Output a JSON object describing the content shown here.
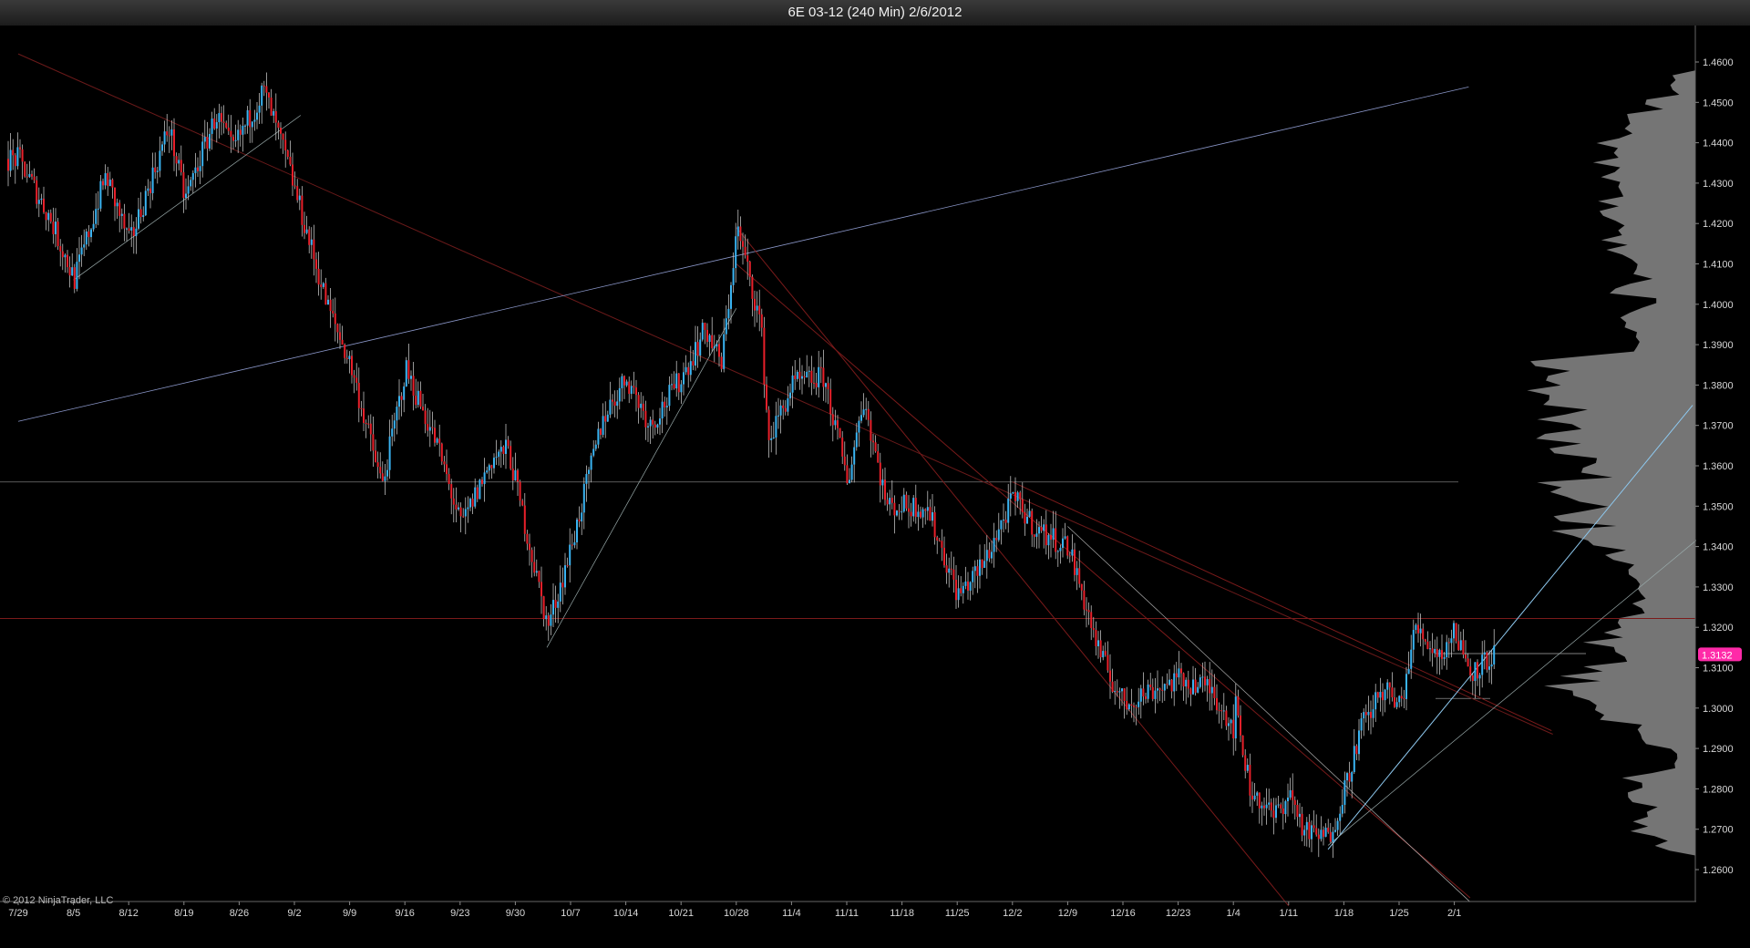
{
  "window": {
    "title": "6E 03-12 (240 Min)  2/6/2012"
  },
  "copyright": "© 2012 NinjaTrader, LLC",
  "chart_data": {
    "type": "candlestick",
    "instrument": "6E 03-12",
    "interval": "240 Min",
    "x_tick_labels": [
      "7/29",
      "8/5",
      "8/12",
      "8/19",
      "8/26",
      "9/2",
      "9/9",
      "9/16",
      "9/23",
      "9/30",
      "10/7",
      "10/14",
      "10/21",
      "10/28",
      "11/4",
      "11/11",
      "11/18",
      "11/25",
      "12/2",
      "12/9",
      "12/16",
      "12/23",
      "1/4",
      "1/11",
      "1/18",
      "1/25",
      "2/1"
    ],
    "y_tick_labels": [
      "1.4600",
      "1.4500",
      "1.4400",
      "1.4300",
      "1.4200",
      "1.4100",
      "1.4000",
      "1.3900",
      "1.3800",
      "1.3700",
      "1.3600",
      "1.3500",
      "1.3400",
      "1.3300",
      "1.3200",
      "1.3100",
      "1.3000",
      "1.2900",
      "1.2800",
      "1.2700",
      "1.2600"
    ],
    "ylim": [
      1.2515,
      1.4725
    ],
    "last_price": "1.3132",
    "grid": false,
    "colors": {
      "background": "#000000",
      "up": "#3ab4f2",
      "down": "#e8202a",
      "wick": "#d8d8d8",
      "price_badge": "#ff2aa8",
      "profile": "#8a8a8a"
    },
    "swing_points": [
      {
        "date": "7/29",
        "price": 1.436
      },
      {
        "date": "8/2",
        "price": 1.421
      },
      {
        "date": "8/5",
        "price": 1.406
      },
      {
        "date": "8/9",
        "price": 1.432
      },
      {
        "date": "8/12",
        "price": 1.415
      },
      {
        "date": "8/17",
        "price": 1.444
      },
      {
        "date": "8/19",
        "price": 1.426
      },
      {
        "date": "8/23",
        "price": 1.447
      },
      {
        "date": "8/25",
        "price": 1.438
      },
      {
        "date": "8/29",
        "price": 1.453
      },
      {
        "date": "9/1",
        "price": 1.435
      },
      {
        "date": "9/6",
        "price": 1.4
      },
      {
        "date": "9/9",
        "price": 1.385
      },
      {
        "date": "9/13",
        "price": 1.355
      },
      {
        "date": "9/16",
        "price": 1.384
      },
      {
        "date": "9/20",
        "price": 1.365
      },
      {
        "date": "9/23",
        "price": 1.345
      },
      {
        "date": "9/27",
        "price": 1.362
      },
      {
        "date": "9/29",
        "price": 1.364
      },
      {
        "date": "10/4",
        "price": 1.32
      },
      {
        "date": "10/7",
        "price": 1.34
      },
      {
        "date": "10/11",
        "price": 1.372
      },
      {
        "date": "10/14",
        "price": 1.382
      },
      {
        "date": "10/17",
        "price": 1.37
      },
      {
        "date": "10/21",
        "price": 1.382
      },
      {
        "date": "10/24",
        "price": 1.394
      },
      {
        "date": "10/26",
        "price": 1.385
      },
      {
        "date": "10/28",
        "price": 1.419
      },
      {
        "date": "10/31",
        "price": 1.395
      },
      {
        "date": "11/1",
        "price": 1.366
      },
      {
        "date": "11/4",
        "price": 1.38
      },
      {
        "date": "11/8",
        "price": 1.382
      },
      {
        "date": "11/11",
        "price": 1.356
      },
      {
        "date": "11/13",
        "price": 1.377
      },
      {
        "date": "11/16",
        "price": 1.35
      },
      {
        "date": "11/18",
        "price": 1.35
      },
      {
        "date": "11/21",
        "price": 1.35
      },
      {
        "date": "11/25",
        "price": 1.328
      },
      {
        "date": "11/28",
        "price": 1.335
      },
      {
        "date": "12/2",
        "price": 1.352
      },
      {
        "date": "12/5",
        "price": 1.344
      },
      {
        "date": "12/9",
        "price": 1.34
      },
      {
        "date": "12/13",
        "price": 1.313
      },
      {
        "date": "12/16",
        "price": 1.301
      },
      {
        "date": "12/20",
        "price": 1.305
      },
      {
        "date": "12/23",
        "price": 1.307
      },
      {
        "date": "12/27",
        "price": 1.305
      },
      {
        "date": "12/30",
        "price": 1.295
      },
      {
        "date": "1/4",
        "price": 1.302
      },
      {
        "date": "1/6",
        "price": 1.28
      },
      {
        "date": "1/9",
        "price": 1.273
      },
      {
        "date": "1/11",
        "price": 1.279
      },
      {
        "date": "1/13",
        "price": 1.269
      },
      {
        "date": "1/16",
        "price": 1.268
      },
      {
        "date": "1/18",
        "price": 1.28
      },
      {
        "date": "1/20",
        "price": 1.295
      },
      {
        "date": "1/23",
        "price": 1.305
      },
      {
        "date": "1/25",
        "price": 1.3
      },
      {
        "date": "1/27",
        "price": 1.32
      },
      {
        "date": "1/30",
        "price": 1.313
      },
      {
        "date": "2/1",
        "price": 1.319
      },
      {
        "date": "2/3",
        "price": 1.309
      },
      {
        "date": "2/6",
        "price": 1.3132
      }
    ]
  }
}
